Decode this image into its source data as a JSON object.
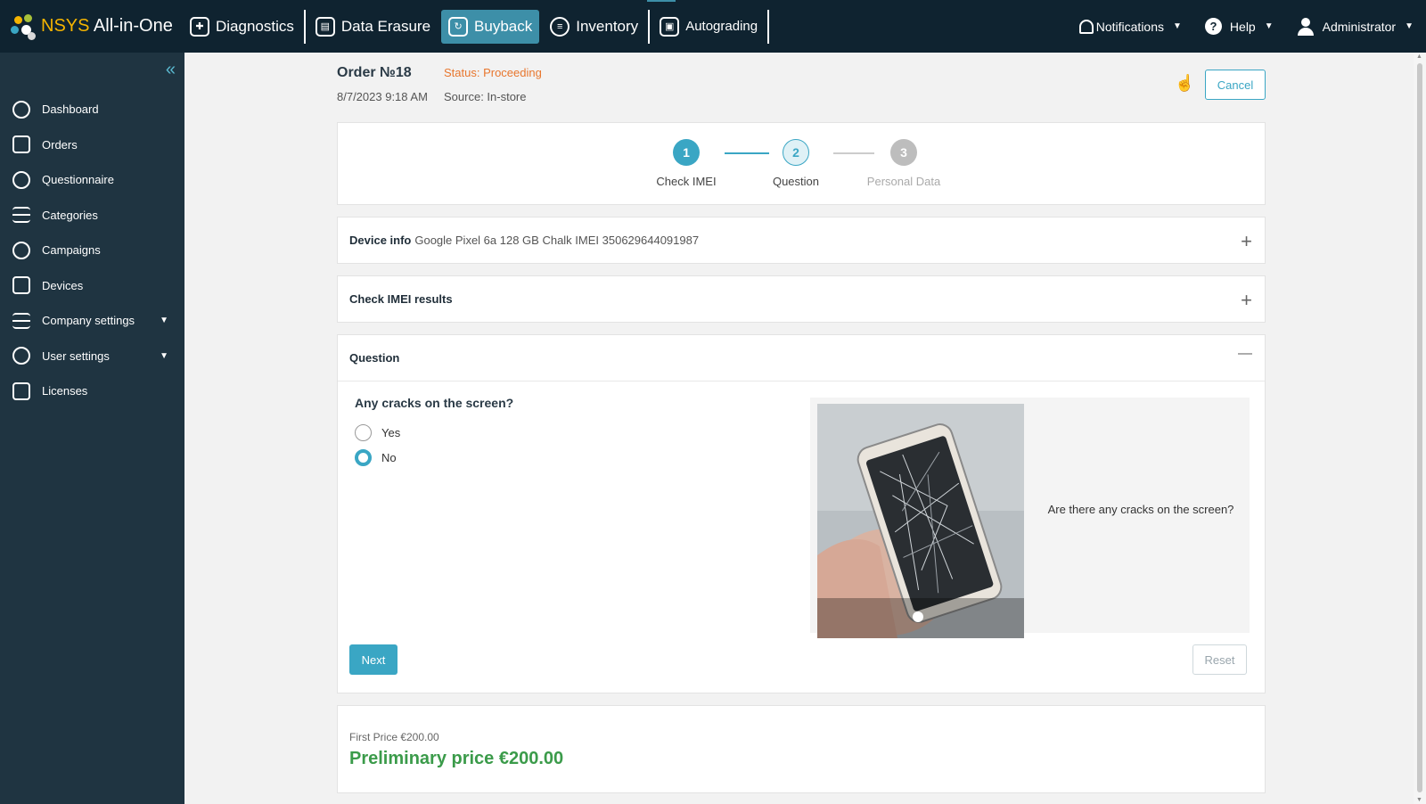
{
  "topbar": {
    "brand_prefix": "NSYS",
    "brand_suffix": " All-in-One",
    "modules": [
      {
        "label": "Diagnostics"
      },
      {
        "label": "Data Erasure"
      },
      {
        "label": "Buyback"
      },
      {
        "label": "Inventory"
      },
      {
        "label": "Autograding"
      }
    ],
    "notifications_label": "Notifications",
    "help_label": "Help",
    "user_label": "Administrator"
  },
  "sidebar": {
    "items": [
      {
        "label": "Dashboard"
      },
      {
        "label": "Orders"
      },
      {
        "label": "Questionnaire"
      },
      {
        "label": "Categories"
      },
      {
        "label": "Campaigns"
      },
      {
        "label": "Devices"
      },
      {
        "label": "Company settings"
      },
      {
        "label": "User settings"
      },
      {
        "label": "Licenses"
      }
    ]
  },
  "order": {
    "title": "Order №18",
    "status": "Status: Proceeding",
    "date": "8/7/2023 9:18 AM",
    "source": "Source: In-store",
    "cancel_label": "Cancel"
  },
  "stepper": {
    "steps": [
      {
        "num": "1",
        "label": "Check IMEI"
      },
      {
        "num": "2",
        "label": "Question"
      },
      {
        "num": "3",
        "label": "Personal Data"
      }
    ]
  },
  "device_info": {
    "label": "Device info",
    "value": "Google Pixel 6a 128 GB Chalk IMEI 350629644091987",
    "toggle": "+"
  },
  "imei_results": {
    "label": "Check IMEI results",
    "toggle": "+"
  },
  "question": {
    "header": "Question",
    "toggle": "—",
    "text": "Any cracks on the screen?",
    "options": [
      {
        "label": "Yes",
        "checked": false
      },
      {
        "label": "No",
        "checked": true
      }
    ],
    "caption": "Are there any cracks on the screen?",
    "next_label": "Next",
    "reset_label": "Reset"
  },
  "price": {
    "first": "First Price €200.00",
    "preliminary": "Preliminary price €200.00"
  },
  "colors": {
    "accent": "#3aa6c4",
    "topbar": "#0f2330",
    "sidebar": "#1f3441",
    "status": "#e8762d",
    "price": "#3b9b4a"
  }
}
